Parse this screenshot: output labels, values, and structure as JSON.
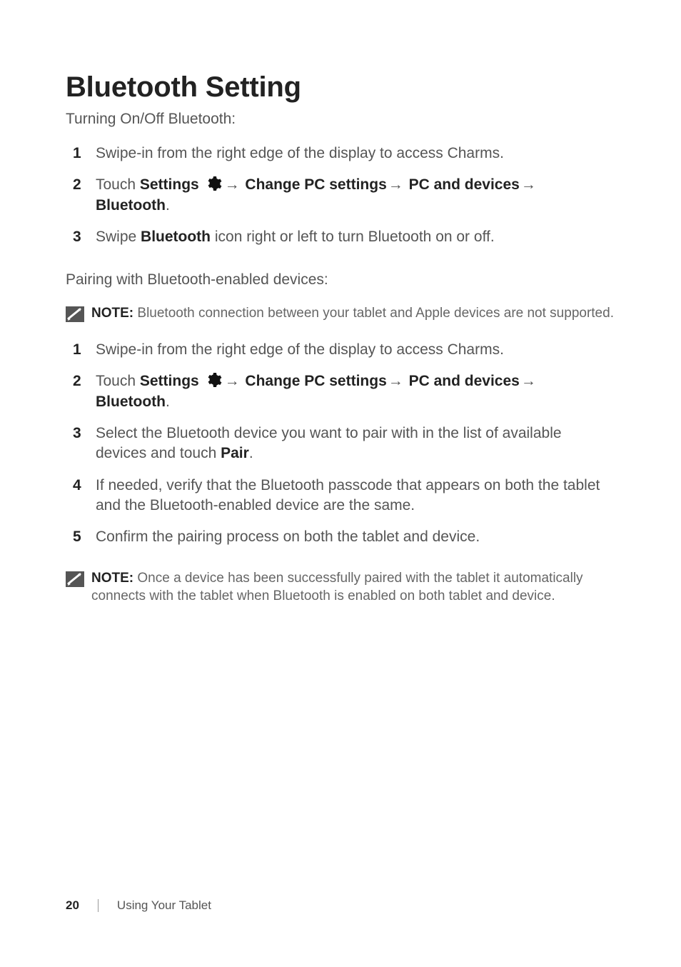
{
  "title": "Bluetooth Setting",
  "section1": {
    "intro": "Turning On/Off Bluetooth:",
    "steps": {
      "n1": "1",
      "s1": "Swipe-in from the right edge of the display to access Charms.",
      "n2": "2",
      "s2_touch": "Touch ",
      "s2_settings": "Settings ",
      "s2_change": " Change PC settings",
      "s2_pc": " PC and devices",
      "s2_bt": "Bluetooth",
      "n3": "3",
      "s3_a": "Swipe ",
      "s3_bt": "Bluetooth",
      "s3_b": " icon right or left to turn Bluetooth on or off."
    }
  },
  "section2": {
    "intro": "Pairing with Bluetooth-enabled devices:",
    "note1_label": "NOTE: ",
    "note1_text": "Bluetooth connection between your tablet and Apple devices are not supported.",
    "steps": {
      "n1": "1",
      "s1": "Swipe-in from the right edge of the display to access Charms.",
      "n2": "2",
      "s2_touch": "Touch ",
      "s2_settings": "Settings ",
      "s2_change": " Change PC settings",
      "s2_pc": " PC and devices",
      "s2_bt": "Bluetooth",
      "n3": "3",
      "s3_a": "Select the Bluetooth device you want to pair with in the list of available devices and touch ",
      "s3_pair": "Pair",
      "n4": "4",
      "s4": "If needed, verify that the Bluetooth passcode that appears on both the tablet and the Bluetooth-enabled device are the same.",
      "n5": "5",
      "s5": "Confirm the pairing process on both the tablet and device."
    },
    "note2_label": "NOTE: ",
    "note2_text": "Once a device has been successfully paired with the tablet it automatically connects with the tablet when Bluetooth is enabled on both tablet and device."
  },
  "arrow": "→",
  "period": ".",
  "footer": {
    "page": "20",
    "chapter": "Using Your Tablet"
  }
}
